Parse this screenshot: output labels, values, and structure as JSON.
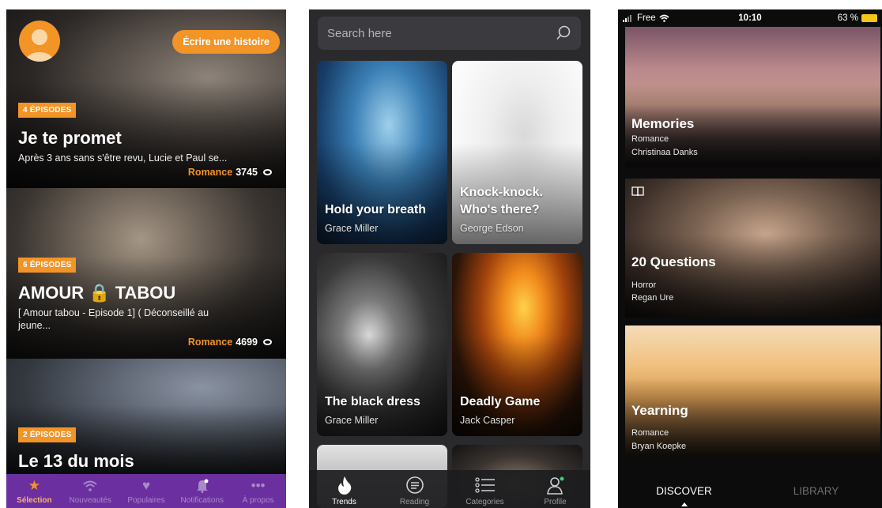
{
  "phone1": {
    "write_button": "Écrire une histoire",
    "stories": [
      {
        "episodes": "4 ÉPISODES",
        "title": "Je te promet",
        "description": "Après 3 ans sans s'être revu, Lucie et Paul se...",
        "genre": "Romance",
        "views": "3745"
      },
      {
        "episodes": "6 ÉPISODES",
        "title": "AMOUR 🔒 TABOU",
        "description": "[ Amour tabou - Episode 1] ( Déconseillé au jeune...",
        "genre": "Romance",
        "views": "4699"
      },
      {
        "episodes": "2 ÉPISODES",
        "title": "Le 13 du mois"
      }
    ],
    "tabs": [
      {
        "label": "Sélection",
        "icon": "star-icon",
        "active": true
      },
      {
        "label": "Nouveautés",
        "icon": "wifi-icon"
      },
      {
        "label": "Populaires",
        "icon": "heart-icon"
      },
      {
        "label": "Notifications",
        "icon": "bell-icon"
      },
      {
        "label": "À propos",
        "icon": "more-icon"
      }
    ],
    "colors": {
      "accent": "#f29426",
      "tabbar": "#6b2fa0"
    }
  },
  "phone2": {
    "search_placeholder": "Search here",
    "books": [
      {
        "title": "Hold your breath",
        "author": "Grace Miller"
      },
      {
        "title": "Knock-knock. Who's there?",
        "author": "George Edson"
      },
      {
        "title": "The black dress",
        "author": "Grace Miller"
      },
      {
        "title": "Deadly Game",
        "author": "Jack Casper"
      }
    ],
    "tabs": [
      {
        "label": "Trends",
        "icon": "flame-icon",
        "active": true
      },
      {
        "label": "Reading",
        "icon": "chat-icon"
      },
      {
        "label": "Categories",
        "icon": "list-icon"
      },
      {
        "label": "Profile",
        "icon": "profile-icon"
      }
    ]
  },
  "phone3": {
    "status": {
      "carrier": "Free",
      "time": "10:10",
      "battery": "63 %"
    },
    "stories": [
      {
        "title": "Memories",
        "genre": "Romance",
        "author": "Christinaa Danks"
      },
      {
        "title": "20 Questions",
        "genre": "Horror",
        "author": "Regan Ure"
      },
      {
        "title": "Yearning",
        "genre": "Romance",
        "author": "Bryan Koepke"
      }
    ],
    "tabs": [
      {
        "label": "DISCOVER",
        "active": true
      },
      {
        "label": "LIBRARY"
      }
    ]
  }
}
